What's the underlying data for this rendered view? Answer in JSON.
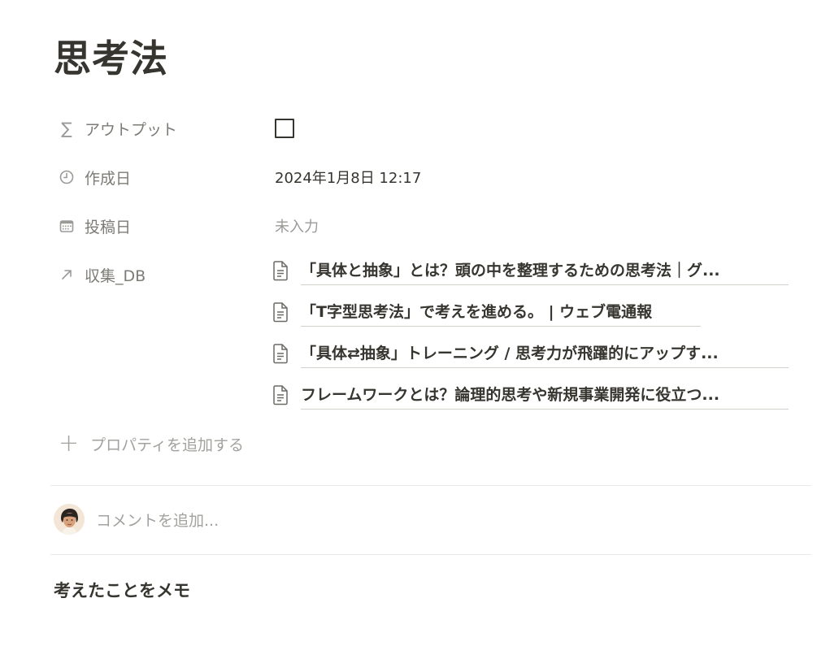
{
  "page": {
    "title": "思考法"
  },
  "properties": {
    "output": {
      "name": "アウトプット",
      "icon": "sigma-icon",
      "checked": false
    },
    "created": {
      "name": "作成日",
      "icon": "clock-icon",
      "value": "2024年1月8日 12:17"
    },
    "posted": {
      "name": "投稿日",
      "icon": "calendar-icon",
      "value": "未入力"
    },
    "collection": {
      "name": "収集_DB",
      "icon": "arrow-up-right-icon",
      "items": [
        "「具体と抽象」とは？頭の中を整理するための思考法｜グ...",
        "「T字型思考法」で考えを進める。 | ウェブ電通報",
        "「具体⇄抽象」トレーニング / 思考力が飛躍的にアップす...",
        "フレームワークとは？論理的思考や新規事業開発に役立つ..."
      ]
    }
  },
  "add_property_label": "プロパティを追加する",
  "comment": {
    "placeholder": "コメントを追加..."
  },
  "body": {
    "memo": "考えたことをメモ"
  },
  "colors": {
    "text": "#37352f",
    "muted": "#7d7b76",
    "placeholder": "#9b9a97",
    "divider": "#ebeae6"
  }
}
